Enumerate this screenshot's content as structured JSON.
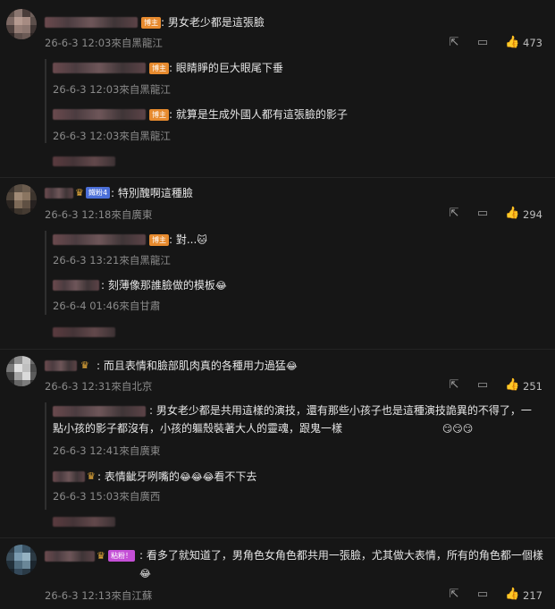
{
  "badges": {
    "author": "博主",
    "fan_level": "鐵粉4",
    "fan_like": "粘粉！"
  },
  "comments": [
    {
      "text": ": 男女老少都是這張臉",
      "meta": "26-6-3 12:03來自黑龍江",
      "likes": "473",
      "replies": [
        {
          "text": ": 眼睛睜的巨大眼尾下垂",
          "meta": "26-6-3 12:03來自黑龍江"
        },
        {
          "text": ": 就算是生成外國人都有這張臉的影子",
          "meta": "26-6-3 12:03來自黑龍江"
        }
      ]
    },
    {
      "text": ": 特別醜啊這種臉",
      "meta": "26-6-3 12:18來自廣東",
      "likes": "294",
      "replies": [
        {
          "text": ": 對...",
          "emoji": "🐱",
          "meta": "26-6-3 13:21來自黑龍江"
        },
        {
          "text": ": 刻薄像那誰臉做的模板",
          "emoji": "😂",
          "meta": "26-6-4 01:46來自甘肅"
        }
      ]
    },
    {
      "text": ": 而且表情和臉部肌肉真的各種用力過猛",
      "emoji": "😂",
      "meta": "26-6-3 12:31來自北京",
      "likes": "251",
      "replies": [
        {
          "text": ": 男女老少都是共用這樣的演技，還有那些小孩子也是這種演技詭異的不得了，一點小孩的影子都沒有，小孩的軀殼裝著大人的靈魂，跟鬼一樣",
          "emoji": "😏😏😏",
          "meta": "26-6-3 12:41來自廣東"
        },
        {
          "text": ": 表情齜牙咧嘴的",
          "emoji": "😂😂😂",
          "text_after": "看不下去",
          "meta": "26-6-3 15:03來自廣西"
        }
      ]
    },
    {
      "text": ": 看多了就知道了，男角色女角色都共用一張臉，尤其做大表情，所有的角色都一個樣",
      "emoji": "😂",
      "meta": "26-6-3 12:13來自江蘇",
      "likes": "217"
    }
  ],
  "icons": {
    "share": "share-icon",
    "comment": "comment-icon",
    "like": "thumbs-up-icon"
  }
}
